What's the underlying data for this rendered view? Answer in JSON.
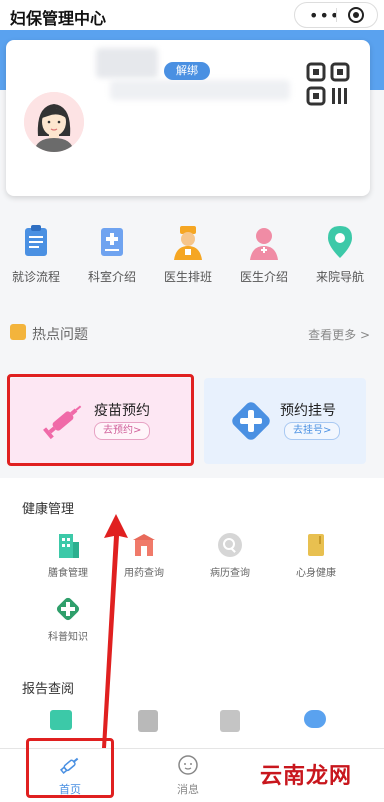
{
  "header": {
    "title": "妇保管理中心"
  },
  "profile": {
    "unbind_label": "解绑"
  },
  "quick_links": [
    {
      "label": "就诊流程",
      "icon": "clipboard-icon"
    },
    {
      "label": "科室介绍",
      "icon": "department-icon"
    },
    {
      "label": "医生排班",
      "icon": "doctor-schedule-icon"
    },
    {
      "label": "医生介绍",
      "icon": "doctor-icon"
    },
    {
      "label": "来院导航",
      "icon": "location-pin-icon"
    }
  ],
  "hot_topics": {
    "title": "热点问题",
    "more": "查看更多 >"
  },
  "booking": [
    {
      "title": "疫苗预约",
      "button": "去预约>",
      "icon": "syringe-icon"
    },
    {
      "title": "预约挂号",
      "button": "去挂号>",
      "icon": "plus-icon"
    }
  ],
  "health": {
    "title": "健康管理",
    "items": [
      {
        "label": "膳食管理",
        "icon": "building-icon"
      },
      {
        "label": "用药查询",
        "icon": "medicine-icon"
      },
      {
        "label": "病历查询",
        "icon": "search-record-icon"
      },
      {
        "label": "心身健康",
        "icon": "book-icon"
      },
      {
        "label": "科普知识",
        "icon": "first-aid-icon"
      }
    ]
  },
  "report": {
    "title": "报告查阅"
  },
  "tabs": [
    {
      "label": "首页",
      "icon": "syringe-tab-icon"
    },
    {
      "label": "消息",
      "icon": "message-icon"
    }
  ],
  "watermark": "云南龙网",
  "colors": {
    "brand_blue": "#5aa2ef",
    "accent_blue": "#4a90e2",
    "highlight_red": "#e02020"
  }
}
